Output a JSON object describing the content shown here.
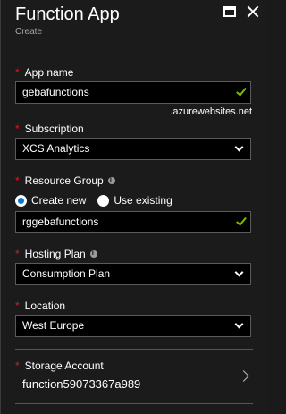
{
  "header": {
    "title": "Function App",
    "subtitle": "Create"
  },
  "app_name": {
    "label": "App name",
    "value": "gebafunctions",
    "suffix": ".azurewebsites.net"
  },
  "subscription": {
    "label": "Subscription",
    "value": "XCS Analytics"
  },
  "resource_group": {
    "label": "Resource Group",
    "options": [
      "Create new",
      "Use existing"
    ],
    "selected": "Create new",
    "value": "rggebafunctions"
  },
  "hosting_plan": {
    "label": "Hosting Plan",
    "value": "Consumption Plan"
  },
  "location": {
    "label": "Location",
    "value": "West Europe"
  },
  "storage_account": {
    "label": "Storage Account",
    "value": "function59073367a989"
  },
  "colors": {
    "background": "#1b1b1b",
    "required": "#e81123",
    "valid": "#7fb900",
    "accent": "#0078d7"
  }
}
